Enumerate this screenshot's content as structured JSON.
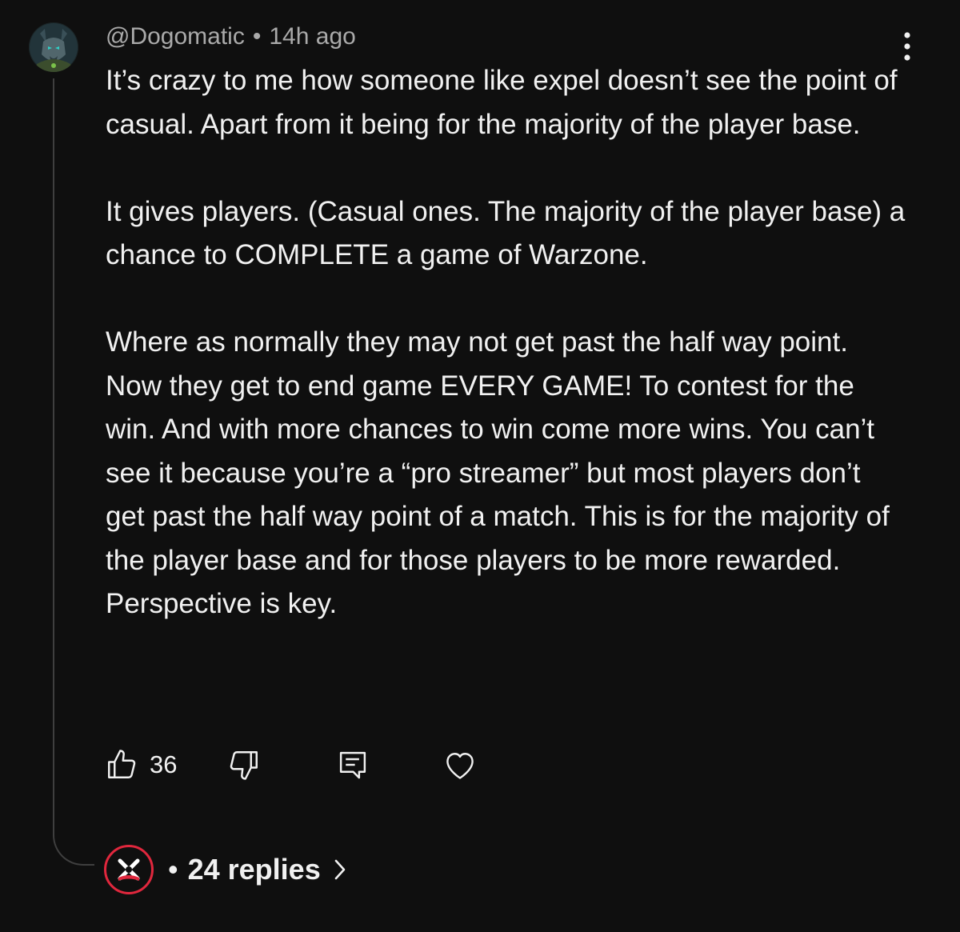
{
  "comment": {
    "author": "@Dogomatic",
    "separator": "•",
    "time": "14h ago",
    "paragraphs": [
      "It’s crazy to me how someone like expel doesn’t see the point of casual. Apart from it being for the majority of the player base.",
      "It gives players. (Casual ones. The majority of the player base) a chance to COMPLETE a game of Warzone.",
      "Where as normally they may not get past the half way point. Now they get to end game EVERY GAME! To contest for the win. And with more chances to win come more wins. You can’t see it because you’re a “pro streamer” but most players don’t get past the half way point of a match. This is for the majority of the player base and for those players to be more rewarded. Perspective is key."
    ],
    "like_count": "36"
  },
  "icons": {
    "menu": "more-vertical-icon",
    "like": "thumbs-up-icon",
    "dislike": "thumbs-down-icon",
    "reply": "reply-comment-icon",
    "heart": "heart-icon",
    "chevron": "chevron-right-icon"
  },
  "replies": {
    "separator": "•",
    "label": "24 replies"
  },
  "colors": {
    "background": "#0f0f0f",
    "text": "#f1f1f1",
    "meta": "#aaaaaa",
    "thread_line": "#3f3f3f",
    "reply_avatar_ring": "#e0273d"
  }
}
